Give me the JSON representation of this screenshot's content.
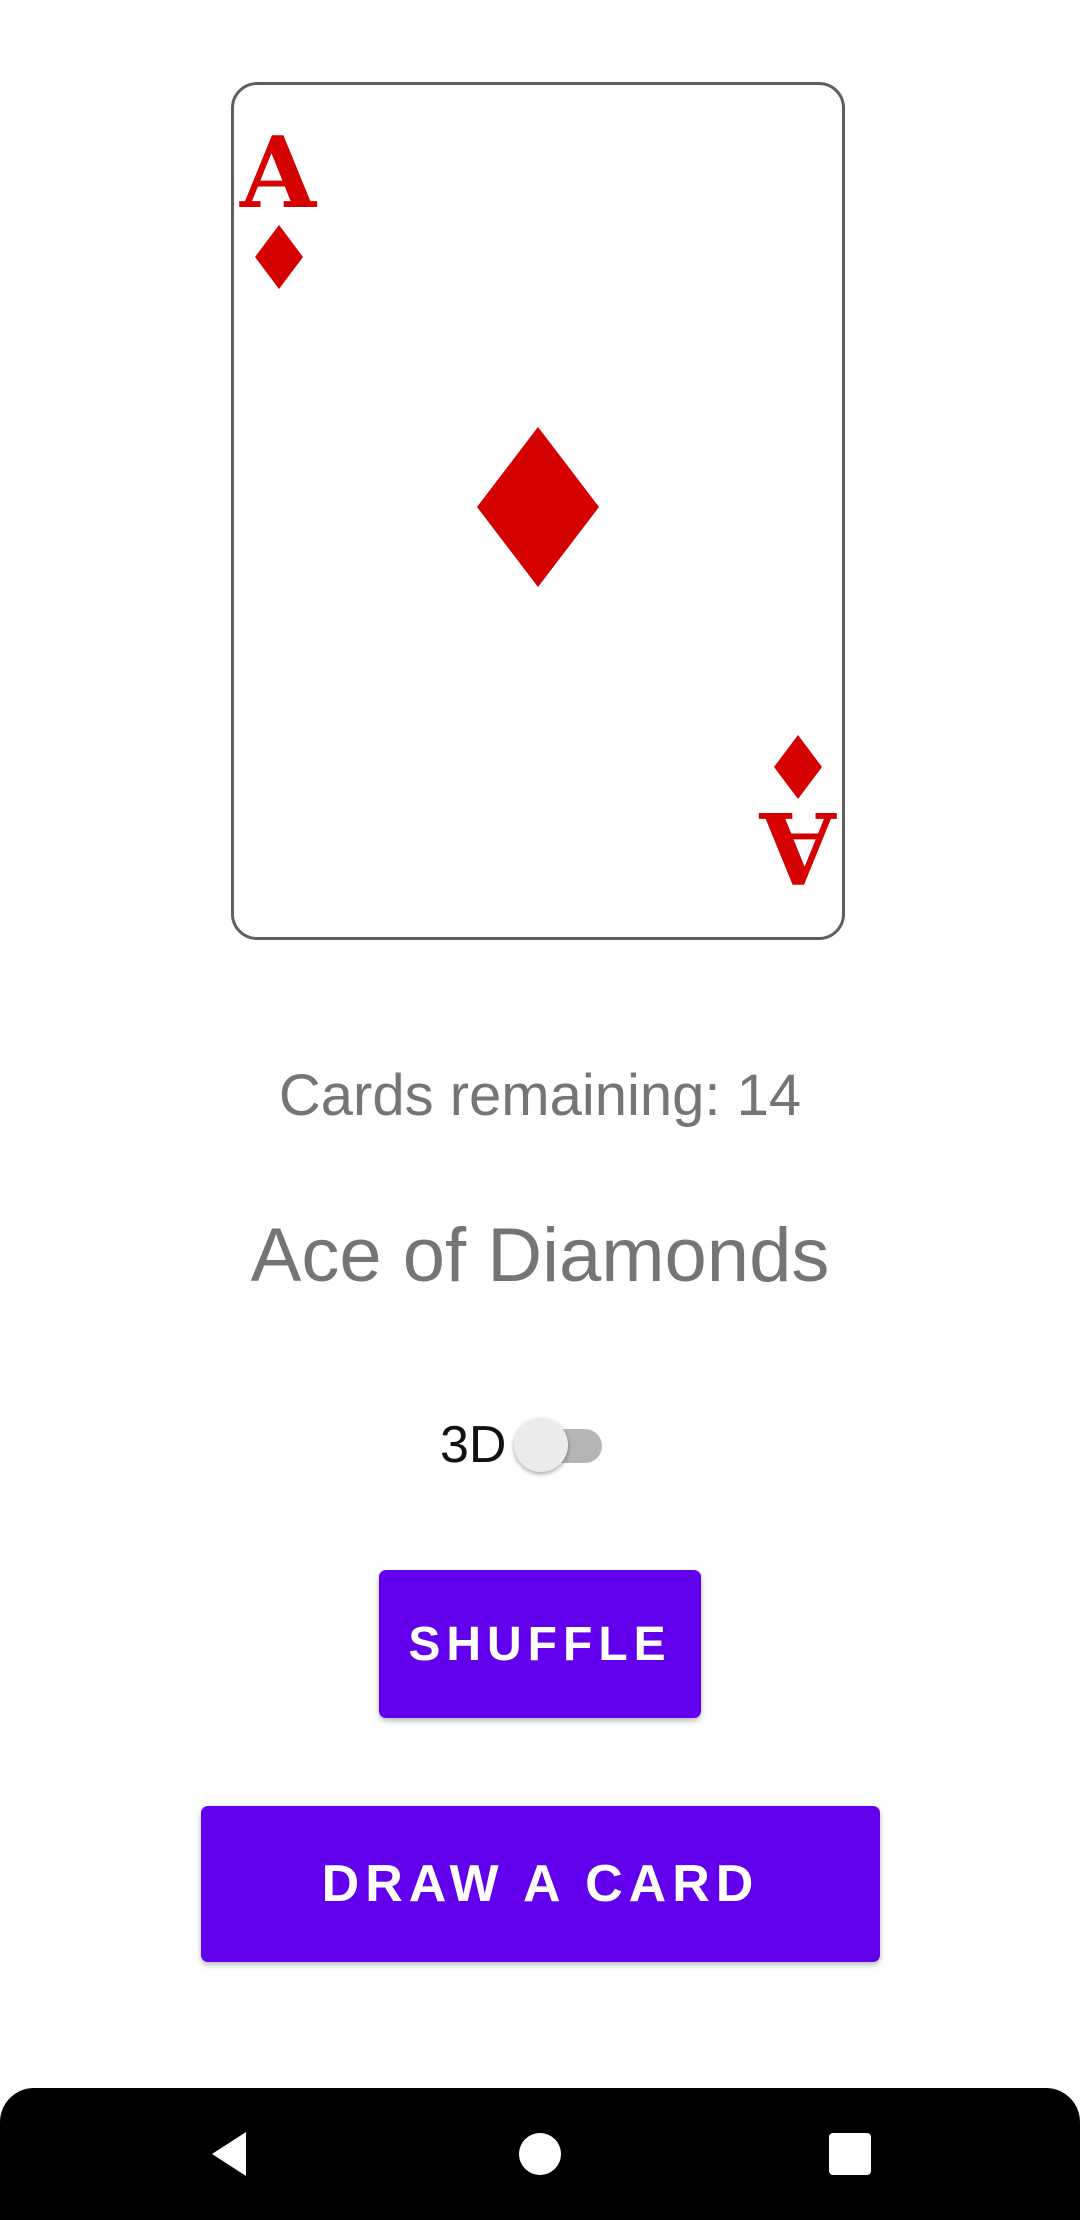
{
  "card": {
    "rank": "A",
    "suit_icon": "diamond-icon",
    "suit_color": "#d50000"
  },
  "status": {
    "remaining": "Cards remaining: 14",
    "current_card": "Ace of Diamonds"
  },
  "controls": {
    "toggle_3d_label": "3D",
    "toggle_3d_on": false,
    "shuffle_label": "Shuffle",
    "draw_label": "Draw a card",
    "accent_color": "#6200ee"
  },
  "navbar": {
    "back_icon": "back-triangle-icon",
    "home_icon": "home-circle-icon",
    "recents_icon": "recents-square-icon"
  }
}
